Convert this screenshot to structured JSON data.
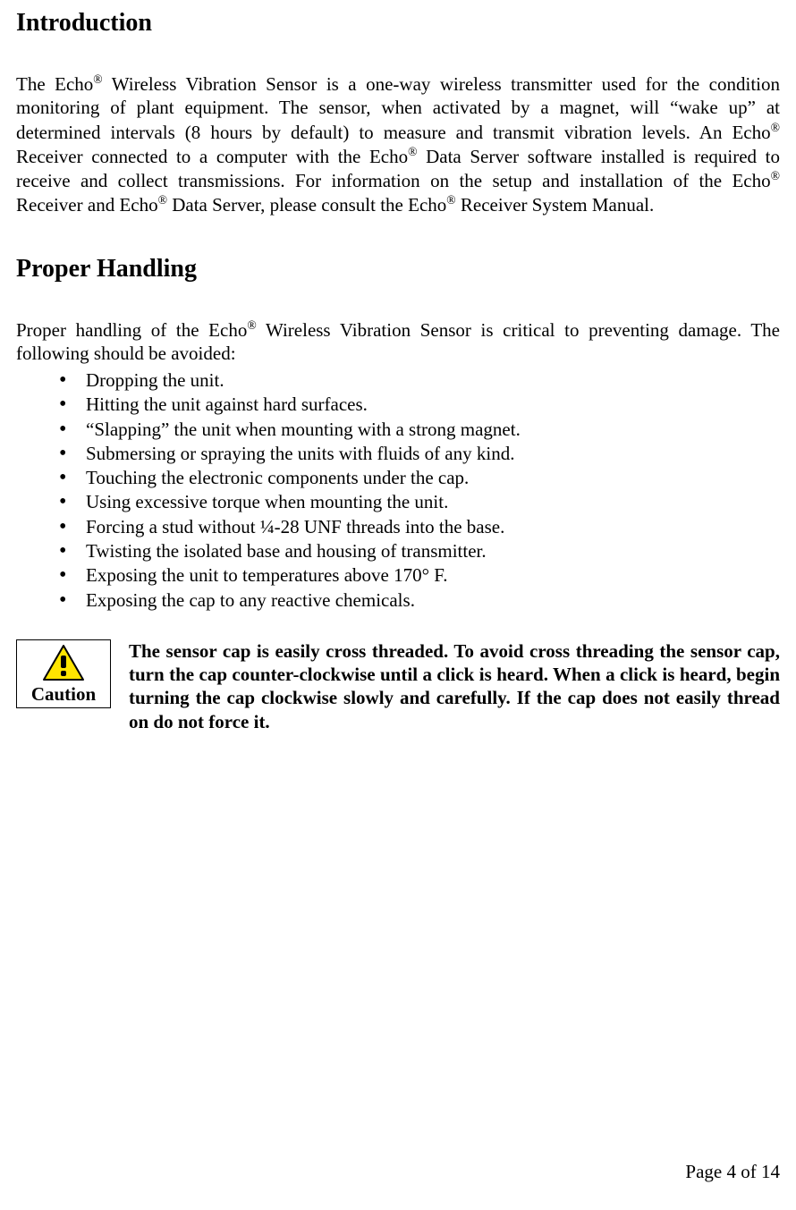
{
  "sections": {
    "intro": {
      "heading": "Introduction",
      "p1_seg1": "The Echo",
      "p1_sup1": "®",
      "p1_seg2": " Wireless Vibration Sensor is a one-way wireless transmitter used for the condition monitoring of plant equipment.   The sensor, when activated by a magnet, will “wake up” at determined intervals (8 hours by default) to measure and transmit vibration levels.  An Echo",
      "p1_sup2": "®",
      "p1_seg3": " Receiver connected to a computer with the Echo",
      "p1_sup3": "®",
      "p1_seg4": " Data Server software installed is required to receive and collect transmissions.  For information on the setup and installation of the Echo",
      "p1_sup4": "®",
      "p1_seg5": " Receiver and Echo",
      "p1_sup5": "®",
      "p1_seg6": " Data Server, please consult the Echo",
      "p1_sup6": "®",
      "p1_seg7": " Receiver System Manual."
    },
    "handling": {
      "heading": "Proper Handling",
      "lead_seg1": "Proper handling of the Echo",
      "lead_sup": "®",
      "lead_seg2": " Wireless Vibration Sensor is critical to preventing damage.  The following should be avoided:",
      "bullets": [
        "Dropping the unit.",
        "Hitting the unit against hard surfaces.",
        "“Slapping” the unit when mounting with a strong magnet.",
        "Submersing or spraying the units with fluids of any kind.",
        "Touching the electronic components under the cap.",
        "Using excessive torque when mounting the unit.",
        "Forcing a stud without ¼-28 UNF threads into the base.",
        "Twisting the isolated base and housing of transmitter.",
        "Exposing the unit to temperatures above 170° F.",
        "Exposing the cap to any reactive chemicals."
      ]
    },
    "caution": {
      "label": "Caution",
      "text": "The sensor cap is easily cross threaded.  To avoid cross threading the sensor cap, turn the cap counter-clockwise until a click is heard.  When a click is heard, begin turning the cap clockwise slowly and carefully.  If the cap does not easily thread on do not force it."
    }
  },
  "footer": {
    "page": "Page 4 of 14"
  }
}
